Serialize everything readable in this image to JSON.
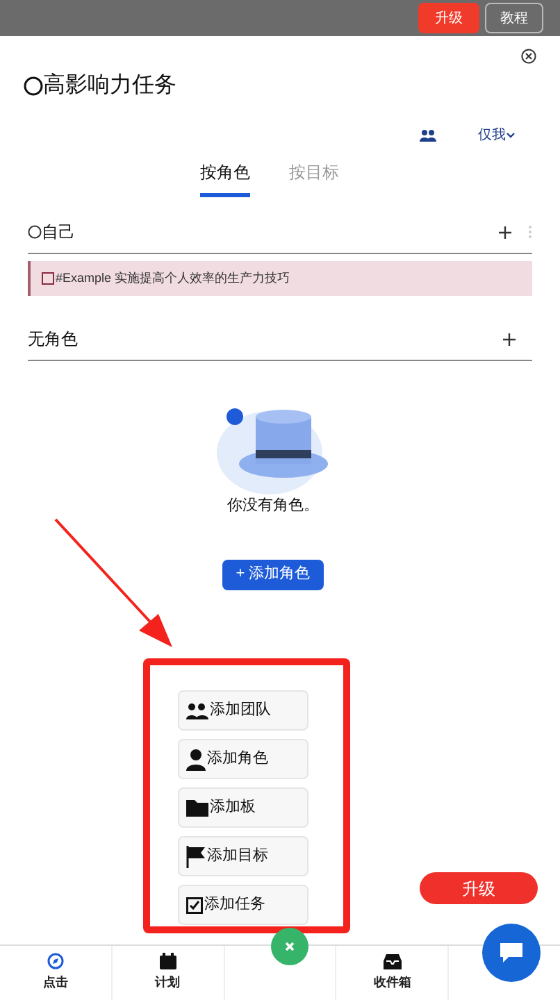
{
  "top_bar": {
    "upgrade": "升级",
    "tutorial": "教程"
  },
  "title": "高影响力任务",
  "filter": {
    "label": "仅我"
  },
  "tabs": [
    {
      "label": "按角色",
      "selected": true
    },
    {
      "label": "按目标",
      "selected": false
    }
  ],
  "sections": [
    {
      "title": "自己",
      "has_circle": true,
      "has_more": true,
      "tasks": [
        {
          "text": "#Example 实施提高个人效率的生产力技巧",
          "checked": false
        }
      ]
    },
    {
      "title": "无角色",
      "has_circle": false,
      "has_more": false
    }
  ],
  "empty_state": {
    "message": "你没有角色。",
    "button": "+ 添加角色"
  },
  "quick_menu": [
    {
      "kind": "team",
      "label": "添加团队"
    },
    {
      "kind": "role",
      "label": "添加角色"
    },
    {
      "kind": "board",
      "label": "添加板"
    },
    {
      "kind": "goal",
      "label": "添加目标"
    },
    {
      "kind": "task",
      "label": "添加任务"
    }
  ],
  "floating_upgrade": "升级",
  "bottom_nav": [
    {
      "kind": "compass",
      "label": "点击"
    },
    {
      "kind": "calendar",
      "label": "计划"
    },
    {
      "kind": "gap"
    },
    {
      "kind": "inbox",
      "label": "收件箱"
    }
  ]
}
